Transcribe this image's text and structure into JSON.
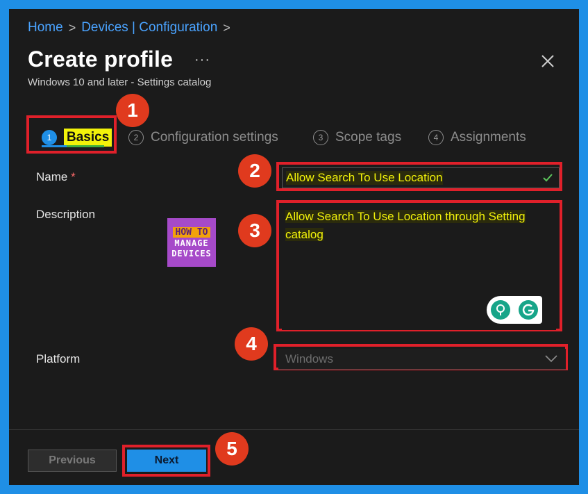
{
  "breadcrumb": {
    "home": "Home",
    "sep1": ">",
    "section": "Devices | Configuration",
    "sep2": ">"
  },
  "header": {
    "title": "Create profile",
    "more": "···",
    "subtitle": "Windows 10 and later - Settings catalog"
  },
  "tabs": [
    {
      "num": "1",
      "label": "Basics"
    },
    {
      "num": "2",
      "label": "Configuration settings"
    },
    {
      "num": "3",
      "label": "Scope tags"
    },
    {
      "num": "4",
      "label": "Assignments"
    }
  ],
  "form": {
    "name_label": "Name",
    "required_mark": "*",
    "name_value": "Allow Search To Use Location",
    "description_label": "Description",
    "description_line1": "Allow Search To Use Location through Setting",
    "description_line2": "catalog",
    "platform_label": "Platform",
    "platform_value": "Windows"
  },
  "footer": {
    "previous": "Previous",
    "next": "Next"
  },
  "steps": [
    "1",
    "2",
    "3",
    "4",
    "5"
  ],
  "logo": {
    "line1": "HOW TO",
    "line2": "MANAGE",
    "line3": "DEVICES"
  },
  "colors": {
    "accent": "#1f8fe6",
    "highlight": "#f2f20a",
    "annotation": "#e0202a",
    "step_badge": "#e03a1e"
  }
}
